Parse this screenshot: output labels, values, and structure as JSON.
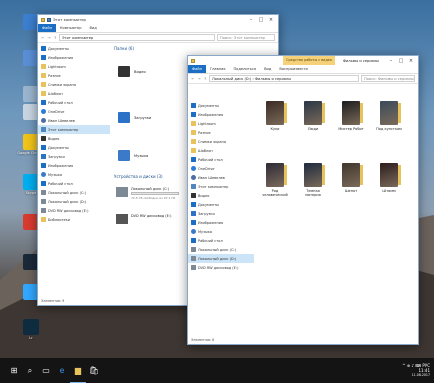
{
  "colors": {
    "accent": "#1a6ec4",
    "folder": "#e8c35c",
    "selection": "#cce4f7",
    "taskbar": "#141414"
  },
  "desktop": {
    "icons": [
      {
        "label": "",
        "color": "#3b7fd0"
      },
      {
        "label": "",
        "color": "#5a8fd6"
      },
      {
        "label": "",
        "color": "#9bb5cf"
      },
      {
        "label": "",
        "color": "#c9d6e2"
      },
      {
        "label": "Google Chrome",
        "color": "#f2c318"
      },
      {
        "label": "Skype",
        "color": "#00aff0"
      },
      {
        "label": "",
        "color": "#d83b2f"
      },
      {
        "label": "",
        "color": "#1b2838"
      },
      {
        "label": "",
        "color": "#31a8ff"
      },
      {
        "label": "Lr",
        "color": "#0f2c3f"
      }
    ]
  },
  "window_left": {
    "title": "Этот компьютер",
    "ribbon_tabs": [
      "Файл",
      "Компьютер",
      "Вид"
    ],
    "address": "Этот компьютер",
    "search_placeholder": "Поиск: Этот компьютер",
    "nav": [
      {
        "label": "Документы",
        "icon": "folder-icon",
        "ic": "blue"
      },
      {
        "label": "Изображения",
        "icon": "pictures-icon",
        "ic": "blue"
      },
      {
        "label": "Lightroom",
        "icon": "folder-icon",
        "ic": "folder"
      },
      {
        "label": "Разное",
        "icon": "folder-icon",
        "ic": "folder"
      },
      {
        "label": "Снимки экрана",
        "icon": "folder-icon",
        "ic": "folder"
      },
      {
        "label": "Шаблон",
        "icon": "folder-icon",
        "ic": "folder"
      },
      {
        "label": "Рабочий стол",
        "icon": "desktop-icon",
        "ic": "blue"
      },
      {
        "label": "OneDrive",
        "icon": "cloud-icon",
        "ic": "cloud"
      },
      {
        "label": "Иван Шевелев",
        "icon": "person-icon",
        "ic": "person"
      },
      {
        "label": "Этот компьютер",
        "icon": "computer-icon",
        "ic": "pc",
        "selected": true
      },
      {
        "label": "Видео",
        "icon": "video-icon",
        "ic": "dark"
      },
      {
        "label": "Документы",
        "icon": "documents-icon",
        "ic": "blue"
      },
      {
        "label": "Загрузки",
        "icon": "download-icon",
        "ic": "down"
      },
      {
        "label": "Изображения",
        "icon": "pictures-icon",
        "ic": "blue"
      },
      {
        "label": "Музыка",
        "icon": "music-icon",
        "ic": "music"
      },
      {
        "label": "Рабочий стол",
        "icon": "desktop-icon",
        "ic": "blue"
      },
      {
        "label": "Локальный диск (C:)",
        "icon": "drive-icon",
        "ic": "drive"
      },
      {
        "label": "Локальный диск (D:)",
        "icon": "drive-icon",
        "ic": "drive"
      },
      {
        "label": "DVD RW дисковод (E:)",
        "icon": "dvd-icon",
        "ic": "drive"
      },
      {
        "label": "Библиотеки",
        "icon": "libraries-icon",
        "ic": "folder"
      }
    ],
    "folders_group": "Папки (6)",
    "folders": [
      "Видео",
      "Загрузки",
      "Музыка"
    ],
    "devices_group": "Устройства и диски (3)",
    "drives": [
      {
        "label": "Локальный диск (C:)",
        "free": "72,5 ГБ свободно из 97,1 ГБ",
        "used_fraction": 0.25
      },
      {
        "label": "DVD RW дисковод (E:)",
        "free": "",
        "used_fraction": 0
      }
    ],
    "status": "Элементов: 9"
  },
  "window_right": {
    "title": "Фильмы и сериалы",
    "context_tab": "Средства работы с видео",
    "ribbon_tabs": [
      "Файл",
      "Главная",
      "Поделиться",
      "Вид",
      "Воспроизвести"
    ],
    "address": "Локальный диск (D:) › Фильмы и сериалы",
    "search_placeholder": "Поиск: Фильмы и сериалы",
    "nav": [
      {
        "label": "Документы",
        "icon": "documents-icon",
        "ic": "blue"
      },
      {
        "label": "Изображения",
        "icon": "pictures-icon",
        "ic": "blue"
      },
      {
        "label": "Lightroom",
        "icon": "folder-icon",
        "ic": "folder"
      },
      {
        "label": "Разное",
        "icon": "folder-icon",
        "ic": "folder"
      },
      {
        "label": "Снимки экрана",
        "icon": "folder-icon",
        "ic": "folder"
      },
      {
        "label": "Шаблон",
        "icon": "folder-icon",
        "ic": "folder"
      },
      {
        "label": "Рабочий стол",
        "icon": "desktop-icon",
        "ic": "blue"
      },
      {
        "label": "OneDrive",
        "icon": "cloud-icon",
        "ic": "cloud"
      },
      {
        "label": "Иван Шевелев",
        "icon": "person-icon",
        "ic": "person"
      },
      {
        "label": "Этот компьютер",
        "icon": "computer-icon",
        "ic": "pc"
      },
      {
        "label": "Видео",
        "icon": "video-icon",
        "ic": "dark"
      },
      {
        "label": "Документы",
        "icon": "documents-icon",
        "ic": "blue"
      },
      {
        "label": "Загрузки",
        "icon": "download-icon",
        "ic": "down"
      },
      {
        "label": "Изображения",
        "icon": "pictures-icon",
        "ic": "blue"
      },
      {
        "label": "Музыка",
        "icon": "music-icon",
        "ic": "music"
      },
      {
        "label": "Рабочий стол",
        "icon": "desktop-icon",
        "ic": "blue"
      },
      {
        "label": "Локальный диск (C:)",
        "icon": "drive-icon",
        "ic": "drive"
      },
      {
        "label": "Локальный диск (D:)",
        "icon": "drive-icon",
        "ic": "drive",
        "selected": true
      },
      {
        "label": "DVD RW дисковод (E:)",
        "icon": "dvd-icon",
        "ic": "drive"
      }
    ],
    "movies": [
      {
        "name": "Куки",
        "color": "#3a2a22"
      },
      {
        "name": "Люди",
        "color": "#2a3646"
      },
      {
        "name": "Мистер Робот",
        "color": "#1c1c1c"
      },
      {
        "name": "Под кунсткам",
        "color": "#3b4a5a"
      },
      {
        "name": "Род человеческий",
        "color": "#2e2a36"
      },
      {
        "name": "Темная материя",
        "color": "#1e2a3e"
      },
      {
        "name": "Шепот",
        "color": "#40362c"
      },
      {
        "name": "Штамм",
        "color": "#2c1c1c"
      }
    ],
    "status": "Элементов: 8"
  },
  "taskbar": {
    "buttons": [
      "start",
      "search",
      "task-view",
      "edge",
      "explorer",
      "store"
    ],
    "tray_text": "^ ⊕ ♪ ⌨ РУС",
    "time": "11:41",
    "date": "11.08.2017"
  }
}
